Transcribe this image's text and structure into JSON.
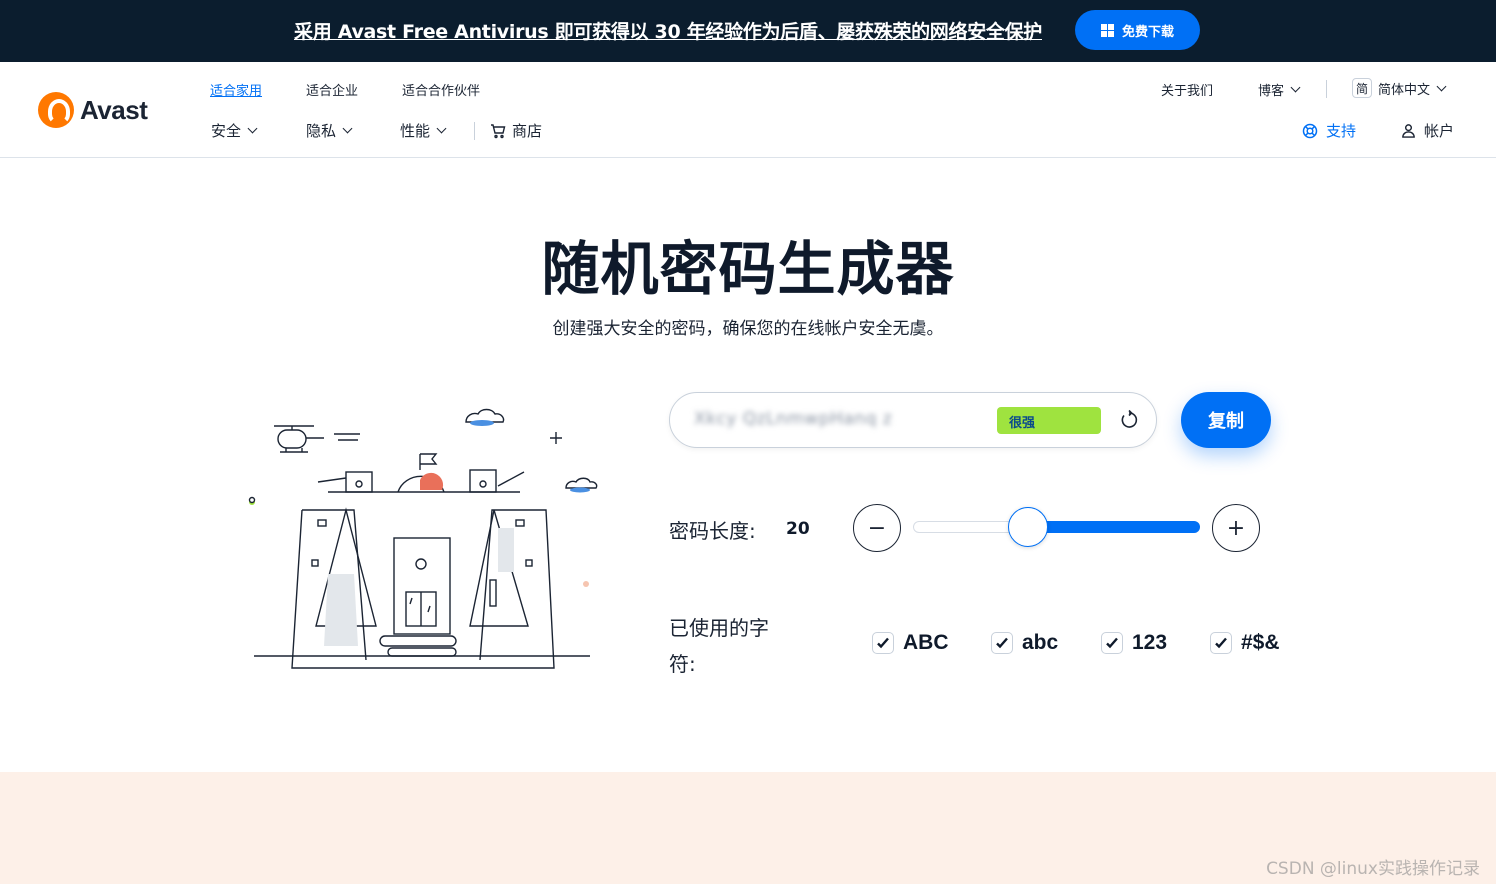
{
  "promo": {
    "text": "采用 Avast Free Antivirus 即可获得以 30 年经验作为后盾、屡获殊荣的网络安全保护",
    "button_label": "免费下载"
  },
  "header": {
    "logo_text": "Avast",
    "segments": [
      "适合家用",
      "适合企业",
      "适合合作伙伴"
    ],
    "active_segment": "适合家用",
    "nav": [
      "安全",
      "隐私",
      "性能"
    ],
    "store_label": "商店",
    "about_label": "关于我们",
    "blog_label": "博客",
    "lang_badge": "简",
    "lang_label": "简体中文",
    "support_label": "支持",
    "account_label": "帐户"
  },
  "hero": {
    "title": "随机密码生成器",
    "subtitle": "创建强大安全的密码，确保您的在线帐户安全无虞。"
  },
  "generator": {
    "password": "Xkcy QzLnmwpHanq z",
    "strength_label": "很强",
    "copy_label": "复制",
    "length_label": "密码长度:",
    "length_value": "20",
    "length_min_symbol": "−",
    "length_max_symbol": "+",
    "slider_fraction": 0.4,
    "chars_label": "已使用的字符:",
    "options": [
      {
        "label": "ABC",
        "checked": true
      },
      {
        "label": "abc",
        "checked": true
      },
      {
        "label": "123",
        "checked": true
      },
      {
        "label": "#$&",
        "checked": true
      }
    ]
  },
  "watermark": "CSDN @linux实践操作记录",
  "colors": {
    "brand_blue": "#0070f5",
    "brand_orange": "#ff7800",
    "strength_green": "#9fe33f",
    "banner_dark": "#0b1d2e",
    "footer_peach": "#fdf0e8"
  }
}
